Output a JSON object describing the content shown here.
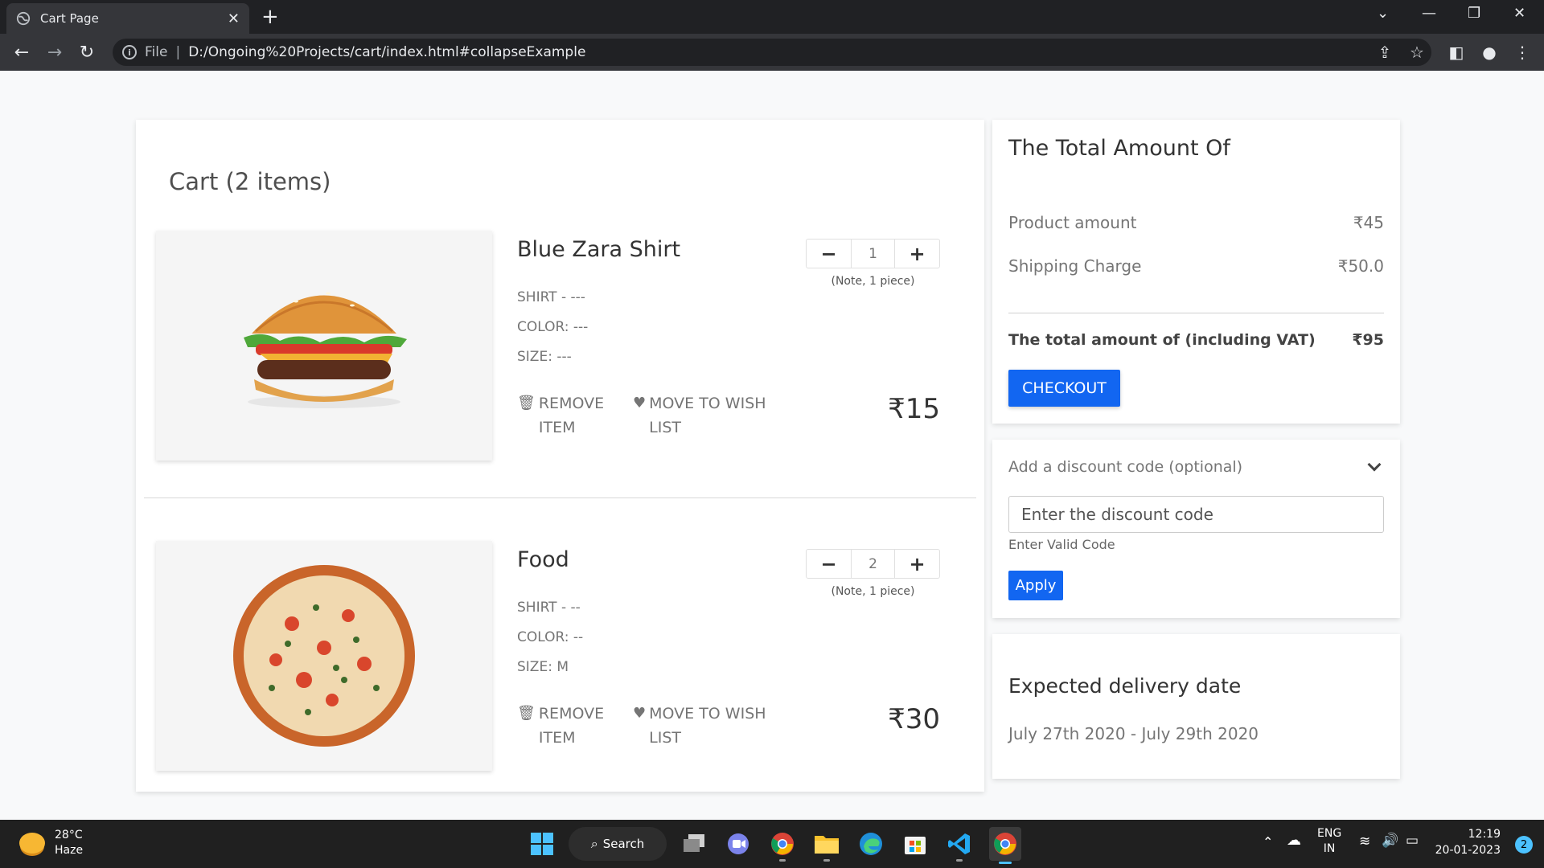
{
  "browser": {
    "tab_title": "Cart Page",
    "url_scheme": "File",
    "url": "D:/Ongoing%20Projects/cart/index.html#collapseExample"
  },
  "cart": {
    "title": "Cart (2 items)",
    "items": [
      {
        "name": "Blue Zara Shirt",
        "attr1": "SHIRT - ---",
        "attr2": "COLOR: ---",
        "attr3": "SIZE: ---",
        "quantity": "1",
        "note": "(Note, 1 piece)",
        "remove_label": "REMOVE ITEM",
        "wish_label": "MOVE TO WISH LIST",
        "price": "₹15",
        "image": "burger"
      },
      {
        "name": "Food",
        "attr1": "SHIRT - --",
        "attr2": "COLOR: --",
        "attr3": "SIZE: M",
        "quantity": "2",
        "note": "(Note, 1 piece)",
        "remove_label": "REMOVE ITEM",
        "wish_label": "MOVE TO WISH LIST",
        "price": "₹30",
        "image": "pizza"
      }
    ]
  },
  "summary": {
    "heading": "The Total Amount Of",
    "product_label": "Product amount",
    "product_value": "₹45",
    "shipping_label": "Shipping Charge",
    "shipping_value": "₹50.0",
    "total_label": "The total amount of (including VAT)",
    "total_value": "₹95",
    "checkout_label": "CHECKOUT"
  },
  "discount": {
    "heading": "Add a discount code (optional)",
    "placeholder": "Enter the discount code",
    "help": "Enter Valid Code",
    "apply_label": "Apply"
  },
  "delivery": {
    "title": "Expected delivery date",
    "range": "July 27th 2020 - July 29th 2020"
  },
  "taskbar": {
    "temp": "28°C",
    "condition": "Haze",
    "search_label": "Search",
    "lang1": "ENG",
    "lang2": "IN",
    "time": "12:19",
    "date": "20-01-2023",
    "notifications": "2"
  },
  "colors": {
    "primary": "#1266f1",
    "chrome_dark": "#202124"
  }
}
